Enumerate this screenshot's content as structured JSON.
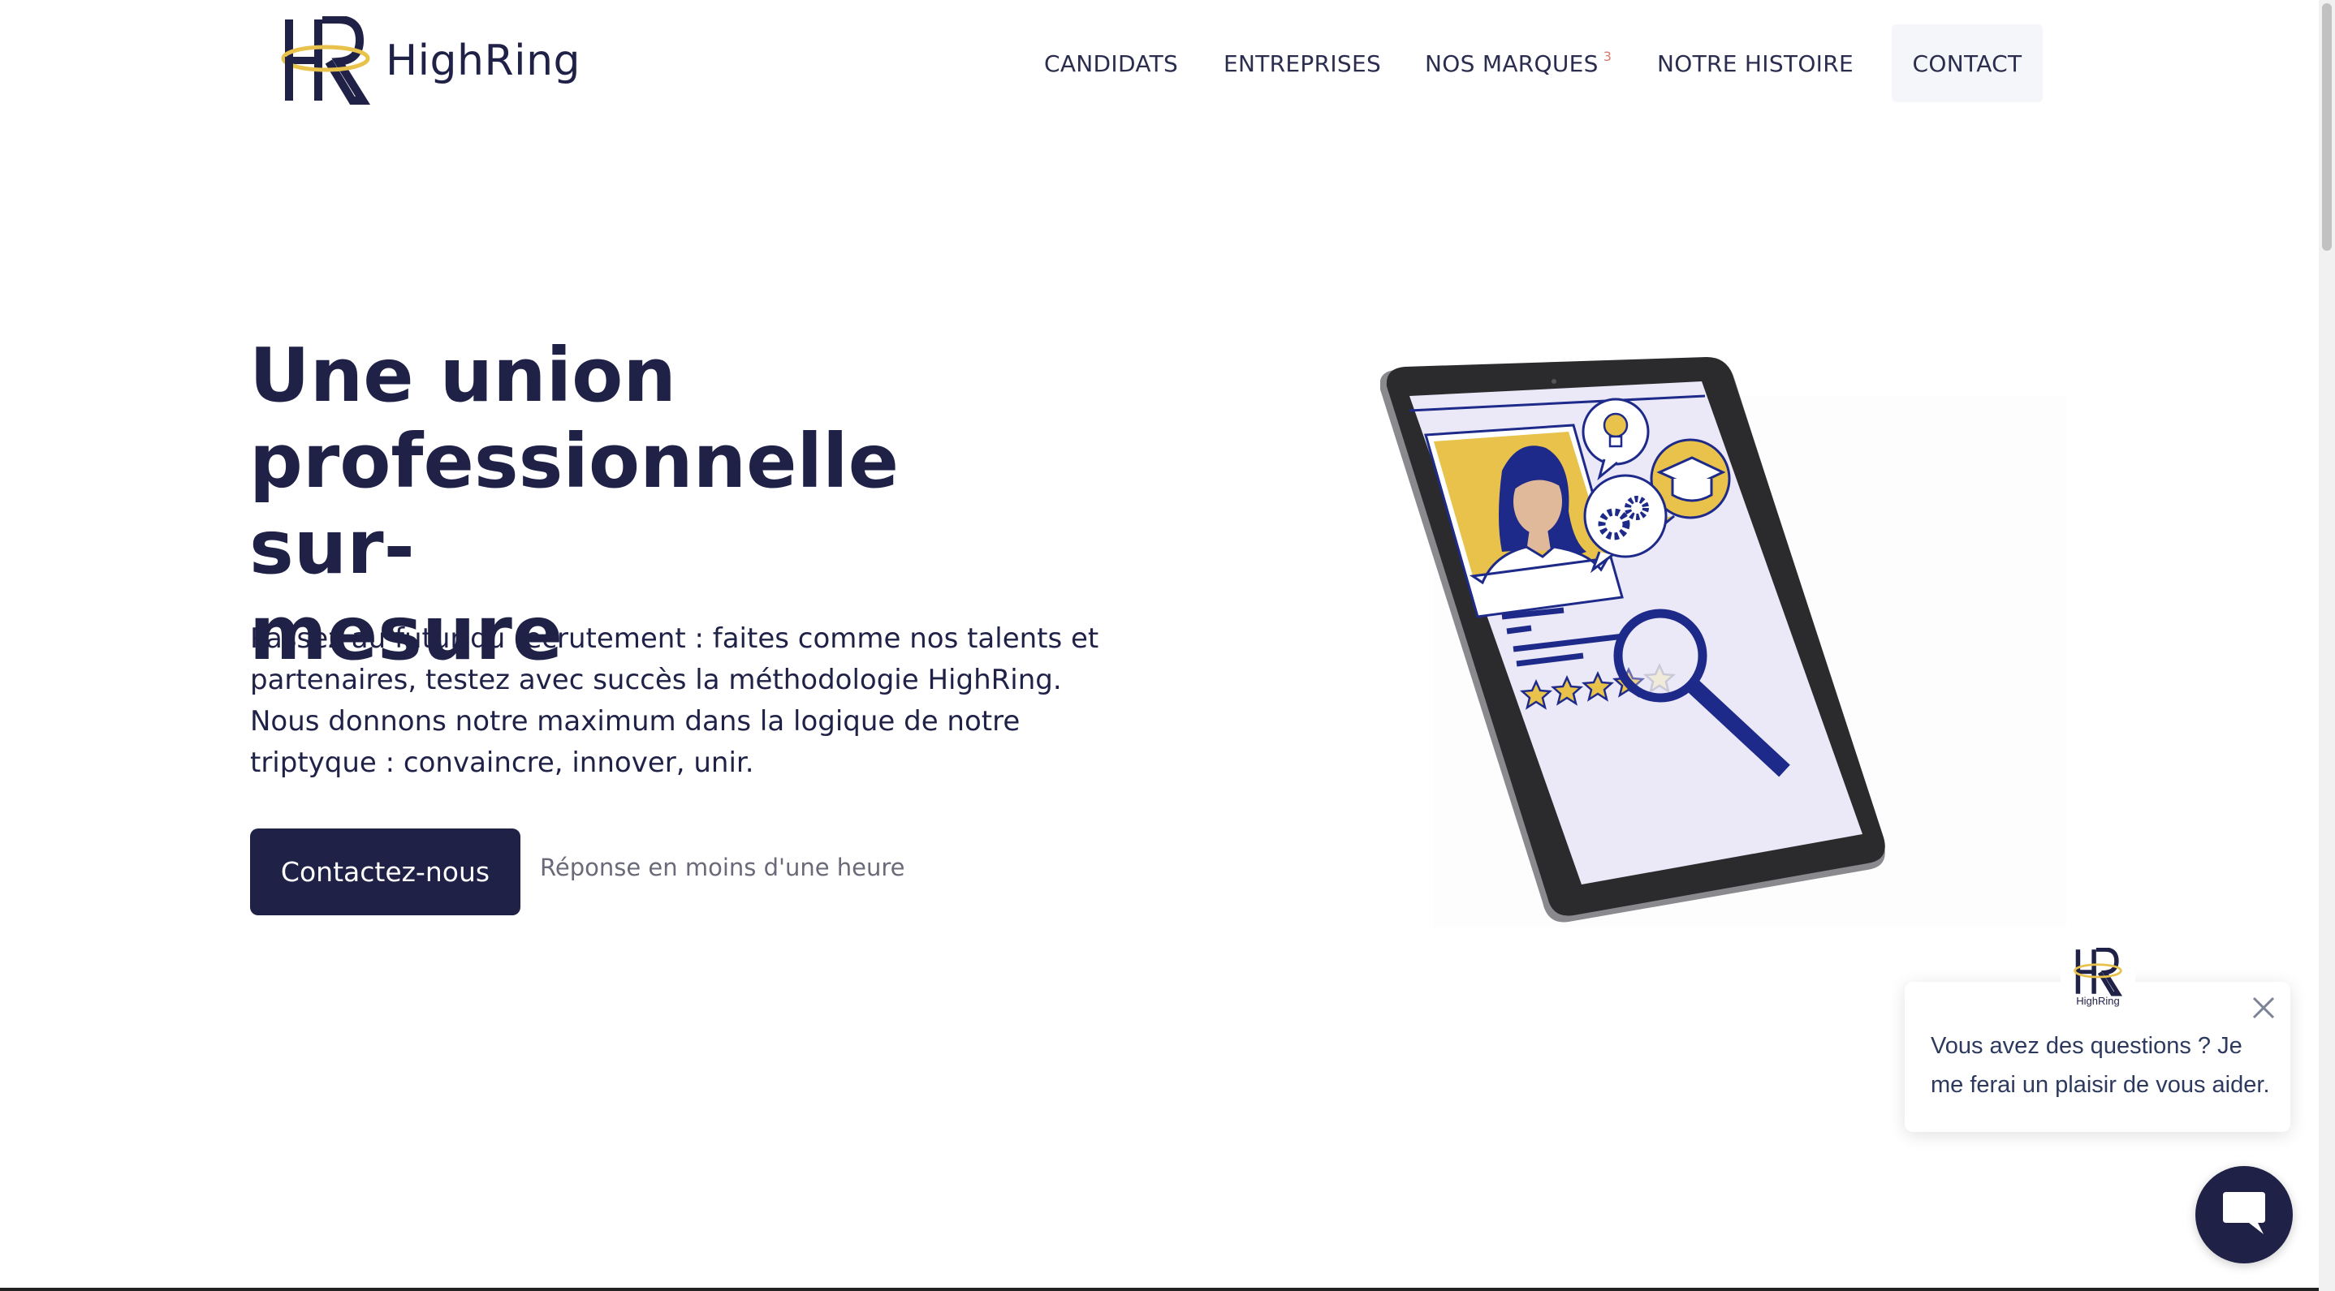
{
  "brand": {
    "name": "HighRing",
    "logo_letters": "HR"
  },
  "nav": {
    "items": [
      {
        "label": "CANDIDATS"
      },
      {
        "label": "ENTREPRISES"
      },
      {
        "label": "NOS MARQUES",
        "badge": "3"
      },
      {
        "label": "NOTRE HISTOIRE"
      },
      {
        "label": "CONTACT"
      }
    ]
  },
  "hero": {
    "title_lines": [
      "Une union",
      "professionnelle sur-",
      "mesure"
    ],
    "description_lines": [
      "Passez au futur du recrutement : faites comme nos talents et",
      "partenaires, testez avec succès la méthodologie HighRing.",
      "Nous donnons notre maximum dans la logique de notre",
      "triptyque : convaincre, innover, unir."
    ],
    "cta_label": "Contactez-nous",
    "cta_note": "Réponse en moins d'une heure"
  },
  "illustration": {
    "rating_stars_filled": 4,
    "rating_stars_total": 5
  },
  "chat": {
    "avatar_label": "HighRing",
    "message_lines": [
      "Vous avez des questions ? Je",
      "me ferai un plaisir de vous aider."
    ]
  },
  "colors": {
    "navy": "#1f2147",
    "gold": "#e8c24a",
    "blue": "#1e2a8a",
    "lavender": "#e8e8f6"
  },
  "icons": [
    "close-icon",
    "chat-bubble-icon",
    "lightbulb-icon",
    "graduation-cap-icon",
    "gears-icon",
    "magnifier-icon",
    "star-icon"
  ]
}
